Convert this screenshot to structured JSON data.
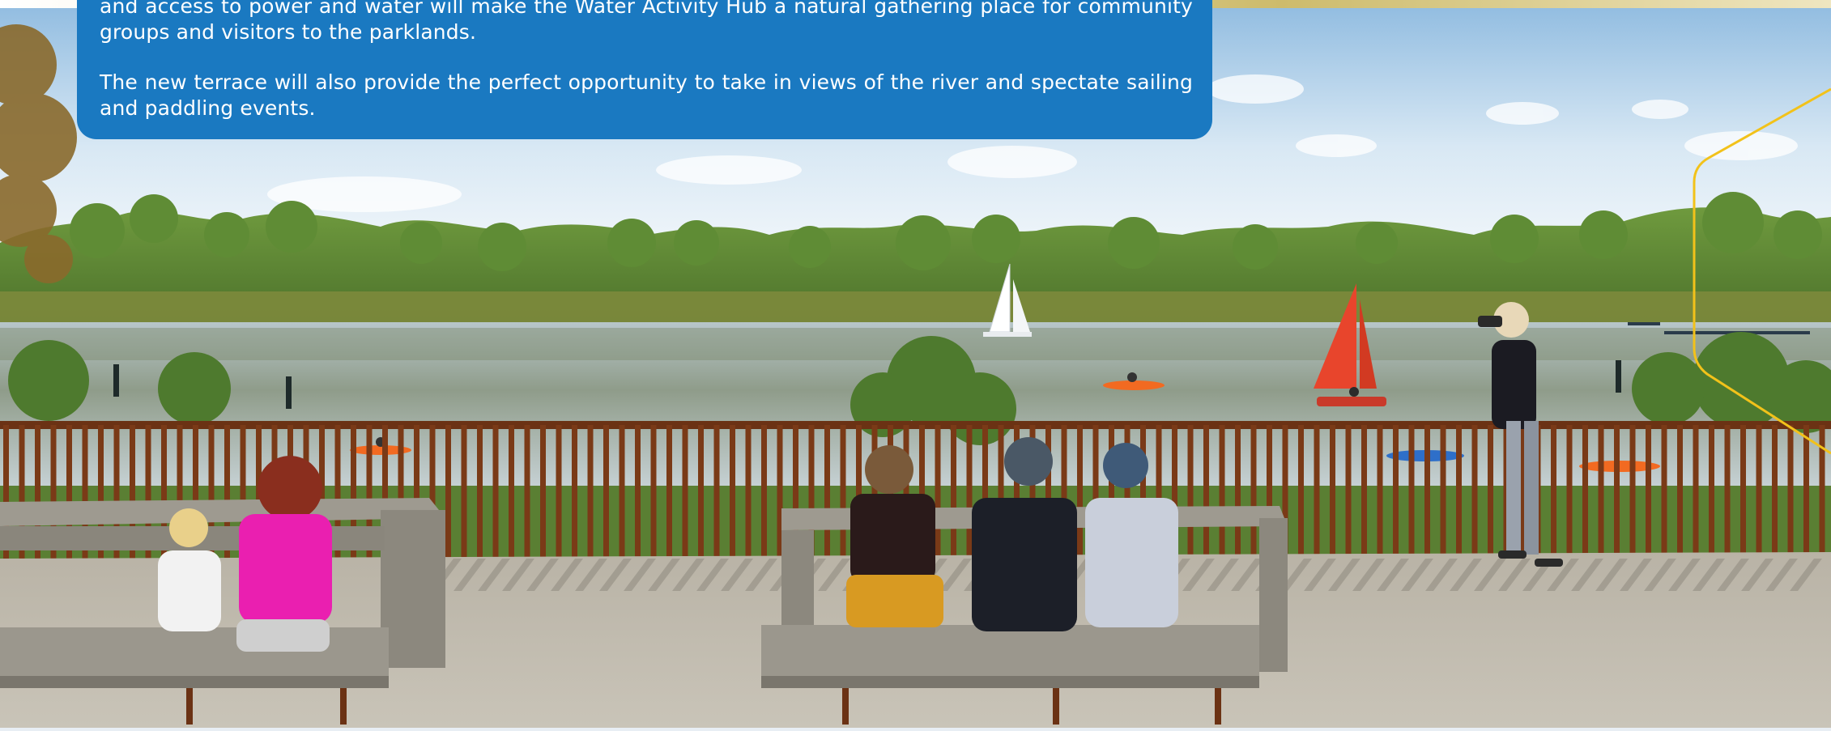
{
  "info_card": {
    "paragraph_1": "and access to power and water will make the Water Activity Hub a natural gathering place for community groups and visitors to the parklands.",
    "paragraph_2": "The new terrace will also provide the perfect opportunity to take in views of the river and spectate sailing and paddling events.",
    "background_color": "#1a79c1",
    "text_color": "#ffffff"
  },
  "illustration": {
    "subject": "riverside-terrace-render",
    "accent_line_color": "#f2c21a",
    "sail_colors": [
      "#ffffff",
      "#e8452c"
    ],
    "railing_color": "#6b3214"
  }
}
